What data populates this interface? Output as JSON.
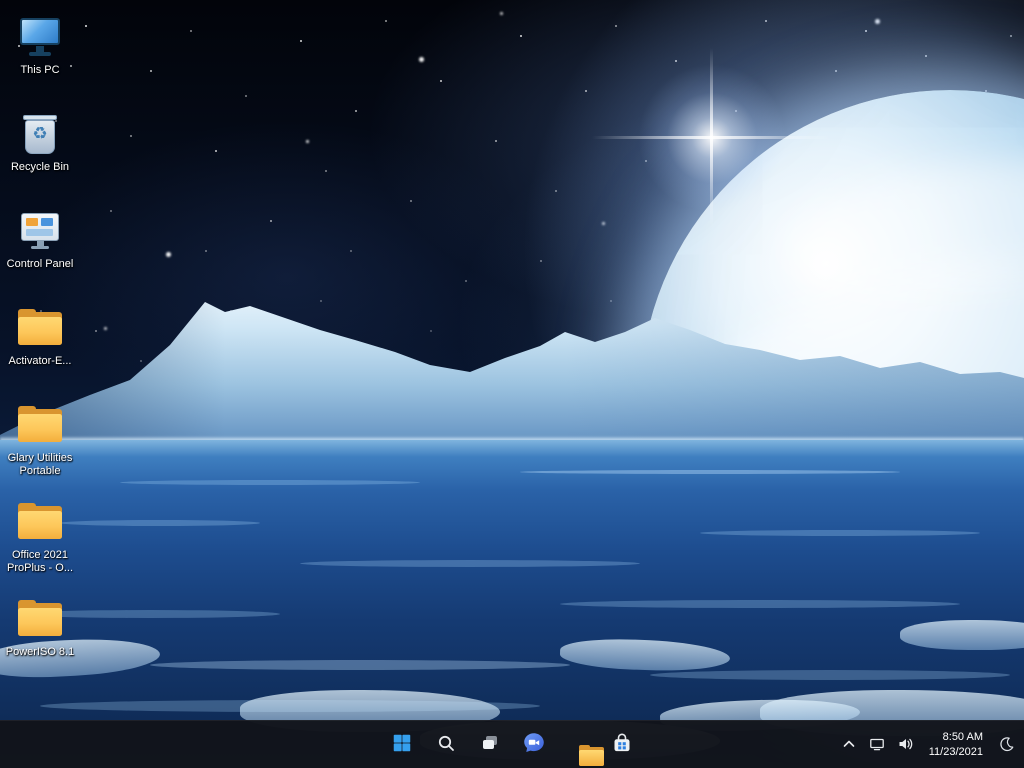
{
  "desktop": {
    "icons": [
      {
        "label": "This PC",
        "icon": "this-pc-icon"
      },
      {
        "label": "Recycle Bin",
        "icon": "recycle-bin-icon"
      },
      {
        "label": "Control Panel",
        "icon": "control-panel-icon"
      },
      {
        "label": "Activator-E...",
        "icon": "folder-icon"
      },
      {
        "label": "Glary Utilities Portable",
        "icon": "folder-icon"
      },
      {
        "label": "Office 2021 ProPlus - O...",
        "icon": "folder-icon"
      },
      {
        "label": "PowerISO 8.1",
        "icon": "folder-icon"
      }
    ]
  },
  "taskbar": {
    "center_icons": [
      "windows-start-icon",
      "search-icon",
      "task-view-icon",
      "chat-icon",
      "file-explorer-icon",
      "store-icon"
    ],
    "tray_icons": [
      "chevron-up-icon",
      "network-icon",
      "volume-icon",
      "moon-icon"
    ],
    "clock": {
      "time": "8:50 AM",
      "date": "11/23/2021"
    }
  },
  "glyphs": {
    "recycle": "♻"
  },
  "colors": {
    "accent_blue": "#3aa5f0",
    "folder_amber": "#f5b945",
    "taskbar_bg": "#12141a",
    "label_text": "#ffffff"
  }
}
